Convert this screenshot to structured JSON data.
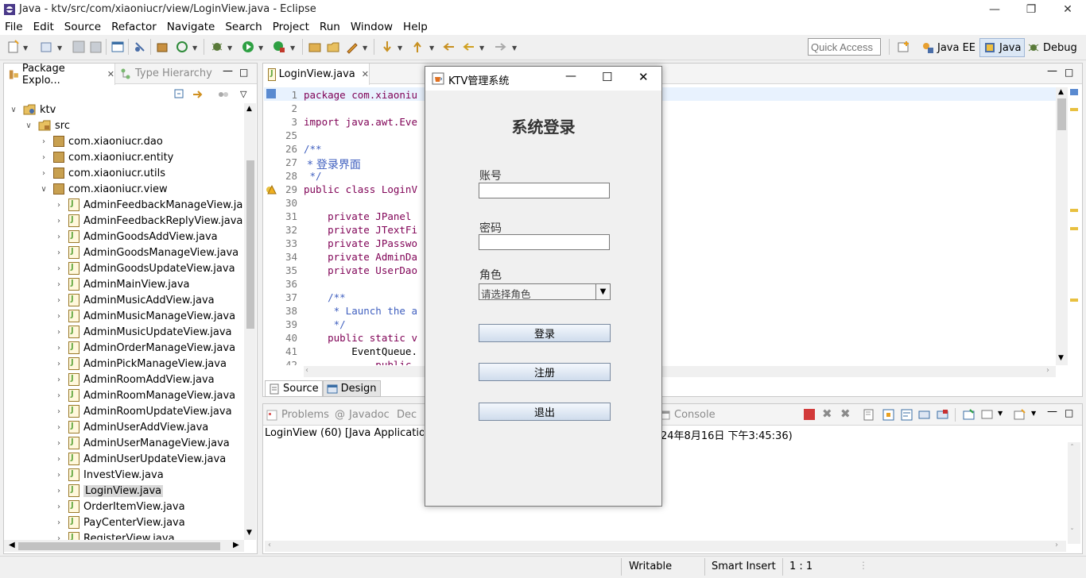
{
  "window": {
    "title": "Java - ktv/src/com/xiaoniucr/view/LoginView.java - Eclipse"
  },
  "menu": [
    "File",
    "Edit",
    "Source",
    "Refactor",
    "Navigate",
    "Search",
    "Project",
    "Run",
    "Window",
    "Help"
  ],
  "quick_access": {
    "placeholder": "Quick Access"
  },
  "perspectives": [
    "Java EE",
    "Java",
    "Debug"
  ],
  "explorer": {
    "tab_label": "Package Explo...",
    "tab2_label": "Type Hierarchy",
    "project": "ktv",
    "src": "src",
    "packages": [
      "com.xiaoniucr.dao",
      "com.xiaoniucr.entity",
      "com.xiaoniucr.utils",
      "com.xiaoniucr.view"
    ],
    "files": [
      "AdminFeedbackManageView.java",
      "AdminFeedbackReplyView.java",
      "AdminGoodsAddView.java",
      "AdminGoodsManageView.java",
      "AdminGoodsUpdateView.java",
      "AdminMainView.java",
      "AdminMusicAddView.java",
      "AdminMusicManageView.java",
      "AdminMusicUpdateView.java",
      "AdminOrderManageView.java",
      "AdminPickManageView.java",
      "AdminRoomAddView.java",
      "AdminRoomManageView.java",
      "AdminRoomUpdateView.java",
      "AdminUserAddView.java",
      "AdminUserManageView.java",
      "AdminUserUpdateView.java",
      "InvestView.java",
      "LoginView.java",
      "OrderItemView.java",
      "PayCenterView.java",
      "RegisterView.java"
    ]
  },
  "editor": {
    "tab_label": "LoginView.java",
    "source_tab": "Source",
    "design_tab": "Design",
    "lines": [
      {
        "num": "1",
        "text": "package com.xiaoniu"
      },
      {
        "num": "2",
        "text": ""
      },
      {
        "num": "3",
        "text": "import java.awt.Eve"
      },
      {
        "num": "25",
        "text": ""
      },
      {
        "num": "26",
        "text": "/**"
      },
      {
        "num": "27",
        "text": " * 登录界面"
      },
      {
        "num": "28",
        "text": " */"
      },
      {
        "num": "29",
        "text": "public class LoginV"
      },
      {
        "num": "30",
        "text": ""
      },
      {
        "num": "31",
        "text": "    private JPanel"
      },
      {
        "num": "32",
        "text": "    private JTextFi"
      },
      {
        "num": "33",
        "text": "    private JPasswo"
      },
      {
        "num": "34",
        "text": "    private AdminDa"
      },
      {
        "num": "35",
        "text": "    private UserDao"
      },
      {
        "num": "36",
        "text": ""
      },
      {
        "num": "37",
        "text": "    /**"
      },
      {
        "num": "38",
        "text": "     * Launch the a"
      },
      {
        "num": "39",
        "text": "     */"
      },
      {
        "num": "40",
        "text": "    public static v"
      },
      {
        "num": "41",
        "text": "        EventQueue."
      },
      {
        "num": "42",
        "text": "            public"
      }
    ]
  },
  "console": {
    "tabs": [
      "Problems",
      "Javadoc",
      "Dec",
      "Console"
    ],
    "run_line_left": "LoginView (60) [Java Application] C",
    "run_line_right": "24年8月16日 下午3:45:36)"
  },
  "status": {
    "writable": "Writable",
    "insert": "Smart Insert",
    "position": "1 : 1"
  },
  "dialog": {
    "title": "KTV管理系统",
    "heading": "系统登录",
    "account_label": "账号",
    "password_label": "密码",
    "role_label": "角色",
    "role_placeholder": "请选择角色",
    "login_button": "登录",
    "register_button": "注册",
    "exit_button": "退出"
  }
}
